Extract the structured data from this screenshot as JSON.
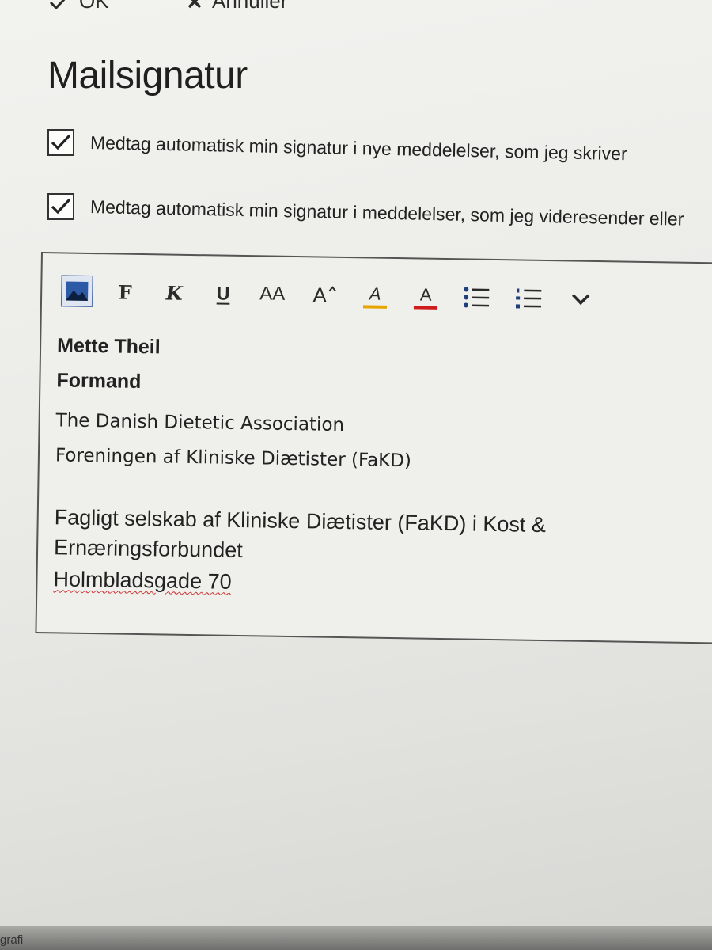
{
  "commands": {
    "ok_label": "OK",
    "cancel_label": "Annuller"
  },
  "title": "Mailsignatur",
  "options": [
    {
      "label": "Medtag automatisk min signatur i nye meddelelser, som jeg skriver",
      "checked": true
    },
    {
      "label": "Medtag automatisk min signatur i meddelelser, som jeg videresender eller",
      "checked": true
    }
  ],
  "toolbar": {
    "icons": [
      "insert-image-icon",
      "bold-icon",
      "italic-icon",
      "underline-icon",
      "font-size-icon",
      "grow-font-icon",
      "highlight-icon",
      "font-color-icon",
      "bullets-icon",
      "numbering-icon",
      "more-chevron-icon"
    ],
    "bold_glyph": "F",
    "italic_glyph": "K",
    "underline_glyph": "U",
    "size_glyph": "AA",
    "grow_glyph": "A",
    "highlight_glyph": "A",
    "color_glyph": "A",
    "highlight_color": "#e8a500",
    "font_color": "#d01c1c"
  },
  "signature": {
    "name": "Mette Theil",
    "role": "Formand",
    "org_en": "The Danish Dietetic Association",
    "org_da": "Foreningen af Kliniske Diætister (FaKD)",
    "society": "Fagligt selskab af Kliniske Diætister (FaKD) i Kost &",
    "federation": "Ernæringsforbundet",
    "address": "Holmbladsgade 70"
  },
  "footer_fragment": "grafi"
}
